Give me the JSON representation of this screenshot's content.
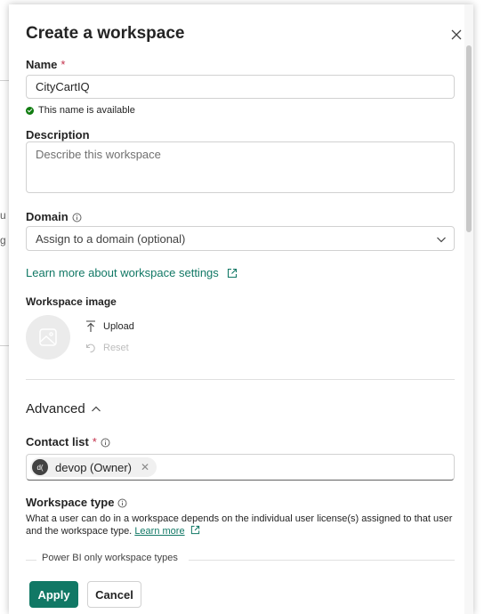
{
  "backdrop": {
    "fragment_1": "u",
    "fragment_2": "g"
  },
  "dialog": {
    "title": "Create a workspace",
    "close_icon": "close-icon"
  },
  "name_field": {
    "label": "Name",
    "required_mark": "*",
    "value": "CityCartIQ",
    "availability": "This name is available"
  },
  "description_field": {
    "label": "Description",
    "placeholder": "Describe this workspace"
  },
  "domain_field": {
    "label": "Domain",
    "placeholder": "Assign to a domain (optional)"
  },
  "settings_link": "Learn more about workspace settings",
  "workspace_image": {
    "label": "Workspace image",
    "upload_label": "Upload",
    "reset_label": "Reset"
  },
  "advanced": {
    "label": "Advanced"
  },
  "contact_list": {
    "label": "Contact list",
    "required_mark": "*",
    "person": {
      "initials": "d(",
      "name": "devop (Owner)"
    }
  },
  "workspace_type": {
    "label": "Workspace type",
    "description": "What a user can do in a workspace depends on the individual user license(s) assigned to that user and the workspace type.",
    "learn_more": "Learn more",
    "group_legend": "Power BI only workspace types"
  },
  "footer": {
    "apply_label": "Apply",
    "cancel_label": "Cancel"
  },
  "colors": {
    "accent": "#117865",
    "success": "#107c10",
    "required": "#c4314b"
  }
}
